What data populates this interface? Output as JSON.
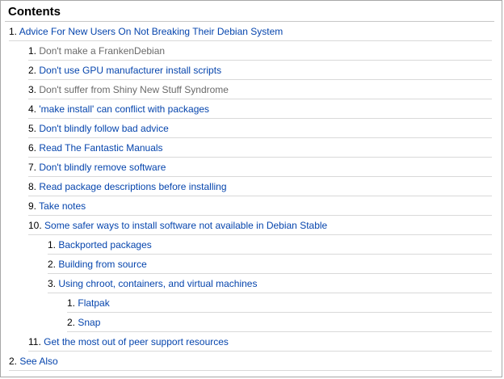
{
  "toc": {
    "title": "Contents",
    "items": [
      {
        "number": "1.",
        "label": "Advice For New Users On Not Breaking Their Debian System",
        "visited": false,
        "level": 0
      },
      {
        "number": "1.",
        "label": "Don't make a FrankenDebian",
        "visited": true,
        "level": 1
      },
      {
        "number": "2.",
        "label": "Don't use GPU manufacturer install scripts",
        "visited": false,
        "level": 1
      },
      {
        "number": "3.",
        "label": "Don't suffer from Shiny New Stuff Syndrome",
        "visited": true,
        "level": 1
      },
      {
        "number": "4.",
        "label": "'make install' can conflict with packages",
        "visited": false,
        "level": 1
      },
      {
        "number": "5.",
        "label": "Don't blindly follow bad advice",
        "visited": false,
        "level": 1
      },
      {
        "number": "6.",
        "label": "Read The Fantastic Manuals",
        "visited": false,
        "level": 1
      },
      {
        "number": "7.",
        "label": "Don't blindly remove software",
        "visited": false,
        "level": 1
      },
      {
        "number": "8.",
        "label": "Read package descriptions before installing",
        "visited": false,
        "level": 1
      },
      {
        "number": "9.",
        "label": "Take notes",
        "visited": false,
        "level": 1
      },
      {
        "number": "10.",
        "label": "Some safer ways to install software not available in Debian Stable",
        "visited": false,
        "level": 1
      },
      {
        "number": "1.",
        "label": "Backported packages",
        "visited": false,
        "level": 2
      },
      {
        "number": "2.",
        "label": "Building from source",
        "visited": false,
        "level": 2
      },
      {
        "number": "3.",
        "label": "Using chroot, containers, and virtual machines",
        "visited": false,
        "level": 2
      },
      {
        "number": "1.",
        "label": "Flatpak",
        "visited": false,
        "level": 3
      },
      {
        "number": "2.",
        "label": "Snap",
        "visited": false,
        "level": 3
      },
      {
        "number": "11.",
        "label": "Get the most out of peer support resources",
        "visited": false,
        "level": 1
      },
      {
        "number": "2.",
        "label": "See Also",
        "visited": false,
        "level": 0
      }
    ]
  },
  "colors": {
    "link": "#0645ad",
    "visited_link": "#6a6a6a",
    "border": "#a7a7a7",
    "row_rule": "#d9d9d9"
  }
}
